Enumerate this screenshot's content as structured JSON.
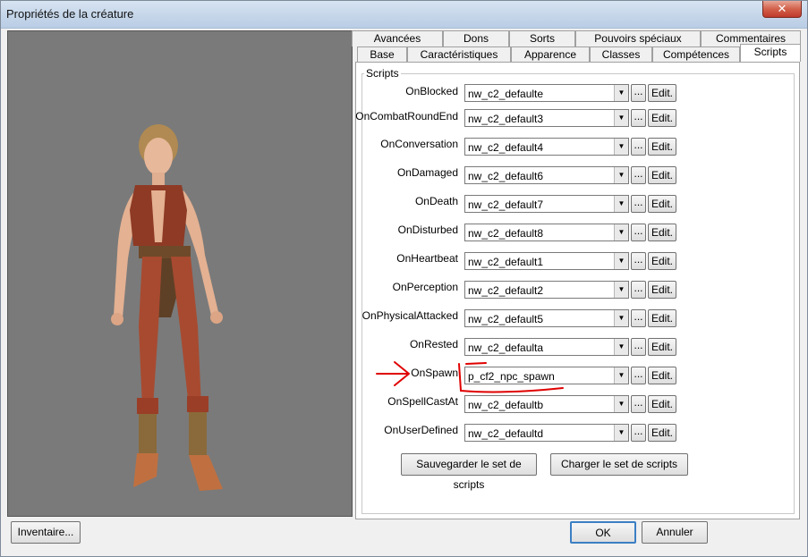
{
  "window": {
    "title": "Propriétés de la créature",
    "close_label": "✕"
  },
  "tabs_row1": [
    "Avancées",
    "Dons",
    "Sorts",
    "Pouvoirs spéciaux",
    "Commentaires"
  ],
  "tabs_row2": [
    "Base",
    "Caractéristiques",
    "Apparence",
    "Classes",
    "Compétences",
    "Scripts"
  ],
  "active_tab": "Scripts",
  "group_label": "Scripts",
  "scripts": [
    {
      "event": "OnBlocked",
      "value": "nw_c2_defaulte"
    },
    {
      "event": "OnCombatRoundEnd",
      "value": "nw_c2_default3"
    },
    {
      "event": "OnConversation",
      "value": "nw_c2_default4"
    },
    {
      "event": "OnDamaged",
      "value": "nw_c2_default6"
    },
    {
      "event": "OnDeath",
      "value": "nw_c2_default7"
    },
    {
      "event": "OnDisturbed",
      "value": "nw_c2_default8"
    },
    {
      "event": "OnHeartbeat",
      "value": "nw_c2_default1"
    },
    {
      "event": "OnPerception",
      "value": "nw_c2_default2"
    },
    {
      "event": "OnPhysicalAttacked",
      "value": "nw_c2_default5"
    },
    {
      "event": "OnRested",
      "value": "nw_c2_defaulta"
    },
    {
      "event": "OnSpawn",
      "value": "p_cf2_npc_spawn"
    },
    {
      "event": "OnSpellCastAt",
      "value": "nw_c2_defaultb"
    },
    {
      "event": "OnUserDefined",
      "value": "nw_c2_defaultd"
    }
  ],
  "browse_label": "...",
  "edit_label": "Edit.",
  "save_set_label": "Sauvegarder le set de scripts",
  "load_set_label": "Charger le set de scripts",
  "inventory_label": "Inventaire...",
  "ok_label": "OK",
  "cancel_label": "Annuler",
  "annotation_color": "#e00000"
}
